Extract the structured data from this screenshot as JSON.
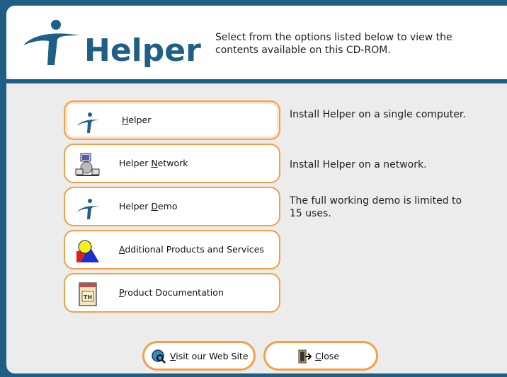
{
  "header": {
    "logo_text": "Helper",
    "description": "Select from the options listed below to view the contents available on this CD-ROM."
  },
  "options": [
    {
      "label_pre": "",
      "label_key": "H",
      "label_post": "elper",
      "description": "Install Helper on a single computer.",
      "icon": "helper-logo-icon"
    },
    {
      "label_pre": "Helper ",
      "label_key": "N",
      "label_post": "etwork",
      "description": "Install Helper on a network.",
      "icon": "network-computers-icon"
    },
    {
      "label_pre": "Helper ",
      "label_key": "D",
      "label_post": "emo",
      "description": "The full working demo is limited to 15 uses.",
      "icon": "helper-logo-icon"
    },
    {
      "label_pre": "",
      "label_key": "A",
      "label_post": "dditional Products and Services",
      "description": "",
      "icon": "shapes-icon"
    },
    {
      "label_pre": "",
      "label_key": "P",
      "label_post": "roduct Documentation",
      "description": "",
      "icon": "document-icon"
    }
  ],
  "bottom": {
    "web_pre": "",
    "web_key": "V",
    "web_post": "isit our Web Site",
    "close_pre": "",
    "close_key": "C",
    "close_post": "lose"
  },
  "colors": {
    "border": "#f5a046",
    "frame": "#1f5f86",
    "logo": "#1f5f86"
  }
}
